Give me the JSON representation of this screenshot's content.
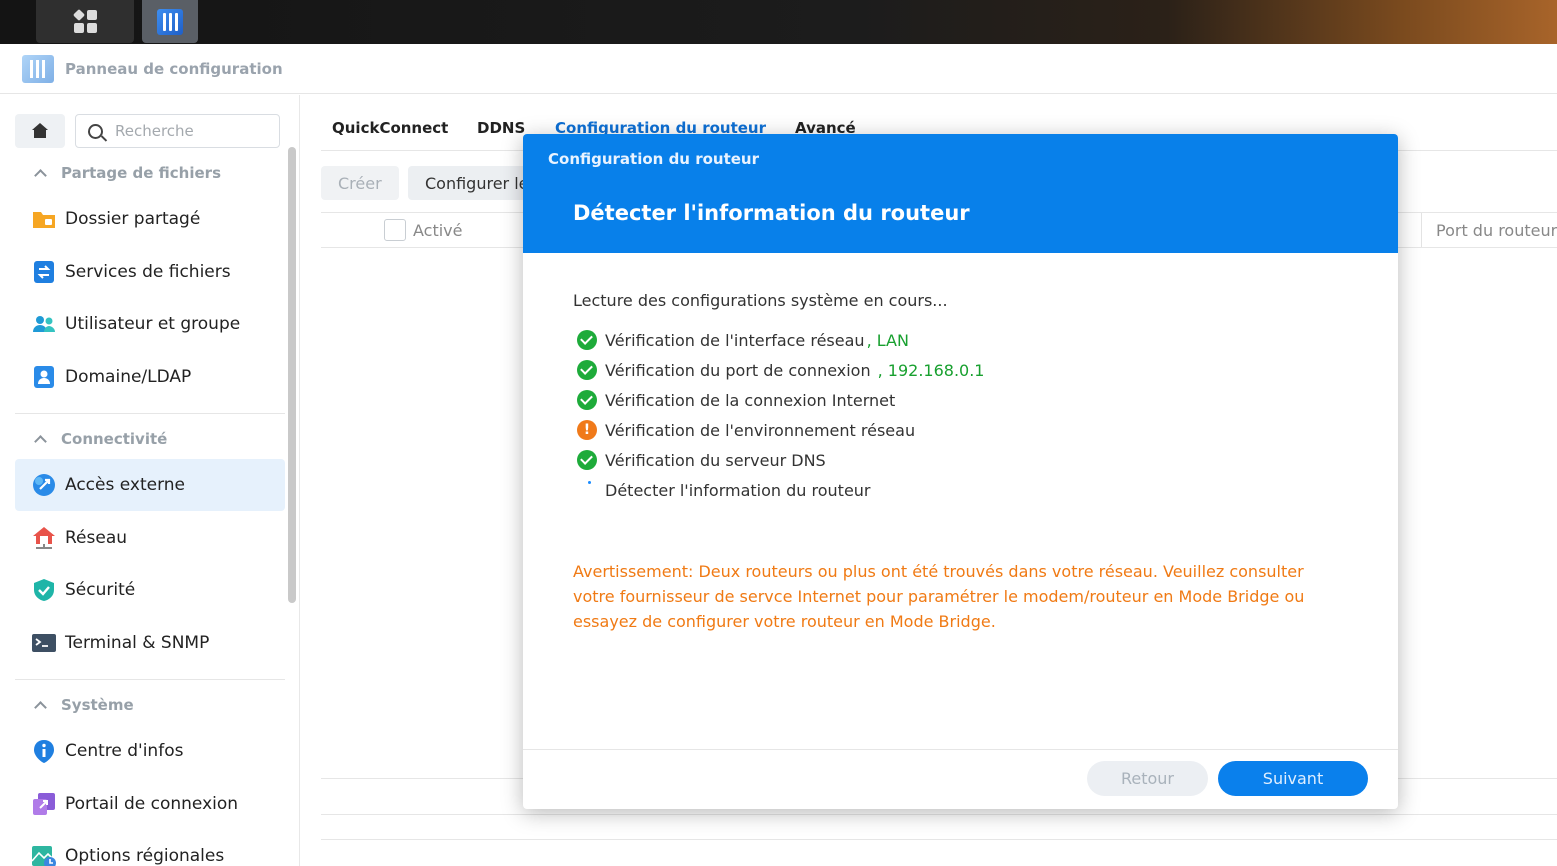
{
  "window": {
    "title": "Panneau de configuration"
  },
  "sidebar": {
    "search_placeholder": "Recherche",
    "sections": {
      "file_sharing": "Partage de fichiers",
      "connectivity": "Connectivité",
      "system": "Système"
    },
    "items": {
      "shared_folder": "Dossier partagé",
      "file_services": "Services de fichiers",
      "user_group": "Utilisateur et groupe",
      "domain_ldap": "Domaine/LDAP",
      "external_access": "Accès externe",
      "network": "Réseau",
      "security": "Sécurité",
      "terminal_snmp": "Terminal & SNMP",
      "info_center": "Centre d'infos",
      "login_portal": "Portail de connexion",
      "regional_options": "Options régionales"
    }
  },
  "main": {
    "tabs": [
      "QuickConnect",
      "DDNS",
      "Configuration du routeur",
      "Avancé"
    ],
    "toolbar": {
      "create": "Créer",
      "configure": "Configurer le routeur"
    },
    "table": {
      "col_enabled": "Activé",
      "col_router_port": "Port du routeur"
    }
  },
  "dialog": {
    "small_title": "Configuration du routeur",
    "title": "Détecter l'information du routeur",
    "lead": "Lecture des configurations système en cours...",
    "steps": [
      {
        "label": "Vérification de l'interface réseau",
        "value": ", LAN",
        "status": "ok"
      },
      {
        "label": "Vérification du port de connexion",
        "value": ", 192.168.0.1",
        "status": "ok"
      },
      {
        "label": "Vérification de la connexion Internet",
        "value": "",
        "status": "ok"
      },
      {
        "label": "Vérification de l'environnement réseau",
        "value": "",
        "status": "warning"
      },
      {
        "label": "Vérification du serveur DNS",
        "value": "",
        "status": "ok"
      },
      {
        "label": "Détecter l'information du routeur",
        "value": "",
        "status": "loading"
      }
    ],
    "warning": "Avertissement: Deux routeurs ou plus ont été trouvés dans votre réseau. Veuillez consulter votre fournisseur de servce Internet pour paramétrer le modem/routeur en Mode Bridge ou essayez de configurer votre routeur en Mode Bridge.",
    "back": "Retour",
    "next": "Suivant"
  },
  "colors": {
    "accent": "#0880ea",
    "ok": "#1eab3a",
    "warning": "#f07a14",
    "value_green": "#18a02f"
  }
}
